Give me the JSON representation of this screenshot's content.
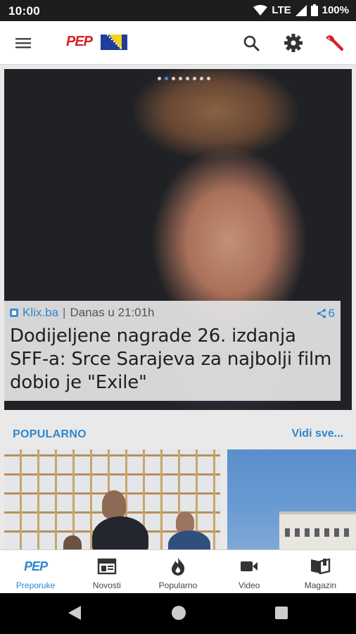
{
  "status_bar": {
    "time": "10:00",
    "network": "LTE",
    "battery": "100%"
  },
  "app_bar": {
    "logo": "PEP"
  },
  "hero": {
    "dots_total": 8,
    "active_dot": 2,
    "source": "Klix.ba",
    "separator": "|",
    "time": "Danas u 21:01h",
    "shares": "6",
    "title": "Dodijeljene nagrade 26. izdanja SFF-a: Srce Sarajeva za najbolji film dobio je \"Exile\""
  },
  "popular": {
    "title": "POPULARNO",
    "more": "Vidi sve..."
  },
  "bottom_nav": {
    "logo": "PEP",
    "items": [
      {
        "label": "Preporuke"
      },
      {
        "label": "Novosti"
      },
      {
        "label": "Popularno"
      },
      {
        "label": "Video"
      },
      {
        "label": "Magazin"
      }
    ]
  },
  "colors": {
    "accent": "#2f86cf",
    "brand_red": "#d61f26"
  }
}
